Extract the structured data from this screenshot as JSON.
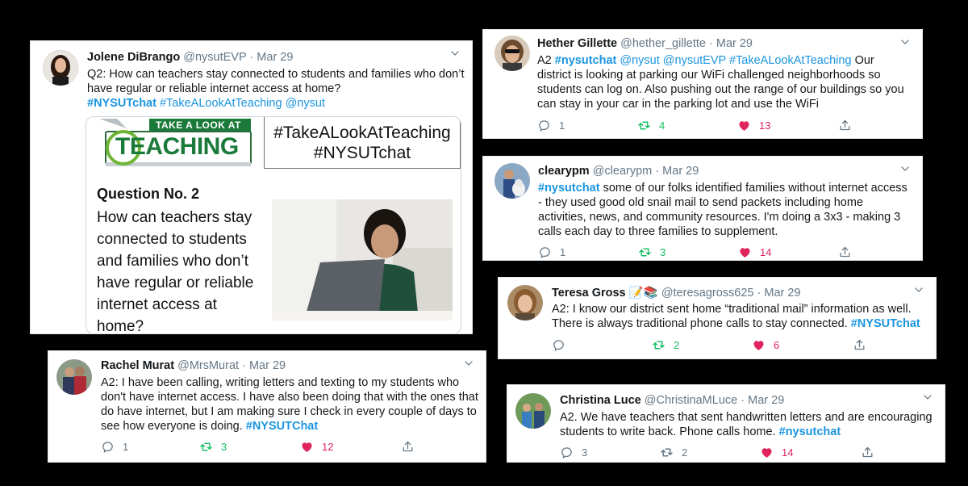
{
  "colors": {
    "link": "#1b95e0",
    "retweet": "#17bf63",
    "like": "#e0245e",
    "meta": "#657786",
    "background": "#000000"
  },
  "icons": [
    "reply-icon",
    "retweet-icon",
    "like-icon",
    "share-icon",
    "chevron-down-icon"
  ],
  "tweets": {
    "jolene": {
      "name": "Jolene DiBrango",
      "handle": "@nysutEVP",
      "dot": "·",
      "date": "Mar 29",
      "text1": "Q2: How can teachers stay connected to students and families who don’t have regular or reliable internet access at home?",
      "tag1": "#NYSUTchat",
      "tag2": "#TakeALookAtTeaching",
      "tag3": "@nysut",
      "image": {
        "logo_top": "TAKE A LOOK AT",
        "logo_main": "TEACHING",
        "hash1": "#TakeALookAtTeaching",
        "hash2": "#NYSUTchat",
        "question_title": "Question No. 2",
        "q_line1": "How can teachers stay",
        "q_line2": "connected to students",
        "q_line3": "and families who don’t",
        "q_line4": "have regular or reliable",
        "q_line5": "internet access at",
        "q_line6": "home?"
      }
    },
    "hether": {
      "name": "Hether Gillette",
      "handle": "@hether_gillette",
      "dot": "·",
      "date": "Mar 29",
      "prefix": "A2",
      "tag1": "#nysutchat",
      "tag2": "@nysut",
      "tag3": "@nysutEVP",
      "tag4": "#TakeALookAtTeaching",
      "body": "Our district is looking at parking our WiFi challenged neighborhoods so students can log on.  Also pushing out the range of our buildings so you can stay in your car in the parking lot and use the WiFi",
      "replies": "1",
      "retweets": "4",
      "likes": "13"
    },
    "cleary": {
      "name": "clearypm",
      "handle": "@clearypm",
      "dot": "·",
      "date": "Mar 29",
      "tag1": "#nysutchat",
      "body": "some of our folks identified families without internet access - they used good old snail mail to send packets including home activities, news, and community resources.  I'm doing a 3x3 - making 3 calls each day to three families to supplement.",
      "replies": "1",
      "retweets": "3",
      "likes": "14"
    },
    "teresa": {
      "name": "Teresa Gross",
      "emoji1": "📝",
      "emoji2": "📚",
      "handle": "@teresagross625",
      "dot": "·",
      "date": "Mar 29",
      "body": "A2: I know our district sent home “traditional mail” information as well. There is always traditional phone calls to stay connected.",
      "tag1": "#NYSUTchat",
      "replies": "",
      "retweets": "2",
      "likes": "6"
    },
    "rachel": {
      "name": "Rachel Murat",
      "handle": "@MrsMurat",
      "dot": "·",
      "date": "Mar 29",
      "body": "A2: I have been calling, writing letters and texting to my students who don't have internet access.  I have also been doing that with the ones that do have internet, but I am making sure I check in every couple of days to see how everyone is doing.",
      "tag1": "#NYSUTChat",
      "replies": "1",
      "retweets": "3",
      "likes": "12"
    },
    "christina": {
      "name": "Christina Luce",
      "handle": "@ChristinaMLuce",
      "dot": "·",
      "date": "Mar 29",
      "body": "A2. We have teachers that sent handwritten letters and are encouraging students to write back. Phone calls home.",
      "tag1": "#nysutchat",
      "replies": "3",
      "retweets": "2",
      "likes": "14"
    }
  }
}
